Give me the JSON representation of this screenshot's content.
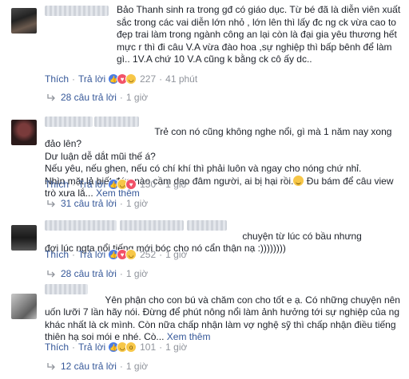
{
  "comments": [
    {
      "text": "Bảo Thanh sinh ra trong gđ có giáo dục. Từ bé đã là diễn viên xuất sắc trong các vai diễn lớn nhỏ , lớn lên thì lấy đc ng ck vừa cao to đẹp trai làm trong ngành công an lại còn là đại gia yêu thương hết mực r thì đi câu V.A vừa đào hoa ,sự nghiệp thì bấp bênh để làm gì.. 1V.A chứ 10 V.A cũng k bằng ck cô ấy dc..",
      "see_more": "",
      "like_label": "Thích",
      "reply_label": "Trả lời",
      "reaction_count": "227",
      "time": "41 phút",
      "replies_label": "28 câu trả lời",
      "replies_time": "1 giờ"
    },
    {
      "text": "Trẻ con nó cũng không nghe nổi, gì mà 1 năm nay xong đảo lên?\nDư luận dễ dắt mũi thế á?\nNếu yêu, nếu ghen, nếu có chí khí thì phải luôn và ngay cho nóng chứ nhỉ.\nNhìn mặt lả biết đứa nào cầm dao đâm người, ai bị hại rồi.",
      "text_tail": " Đu bám để câu view trò xưa lắ...",
      "see_more": "Xem thêm",
      "like_label": "Thích",
      "reply_label": "Trả lời",
      "reaction_count": "150",
      "time": "1 giờ",
      "replies_label": "31 câu trả lời",
      "replies_time": "1 giờ"
    },
    {
      "text": "chuyện từ lúc có bầu nhưng đợi lúc ngta nổi tiếng mới bóc cho nó cẩn thận nạ :))))))))",
      "see_more": "",
      "like_label": "Thích",
      "reply_label": "Trả lời",
      "reaction_count": "252",
      "time": "1 giờ",
      "replies_label": "28 câu trả lời",
      "replies_time": "1 giờ"
    },
    {
      "text": "Yên phận cho con bú và chăm con cho tốt e ạ. Có những chuyện nên uốn lưỡi 7 lần hãy nói. Đừng để phút nông nổi làm ảnh hưởng tới sự nghiệp của ng khác nhất là ck mình. Còn nữa chấp nhận làm vợ nghệ sỹ thì chấp nhận điều tiếng thiên hạ soi mói e nhé. Cò...",
      "see_more": "Xem thêm",
      "like_label": "Thích",
      "reply_label": "Trả lời",
      "reaction_count": "101",
      "time": "1 giờ",
      "replies_label": "12 câu trả lời",
      "replies_time": "1 giờ"
    }
  ],
  "icons": {
    "like": "like-icon",
    "love": "love-icon",
    "haha": "haha-icon",
    "wow": "wow-icon",
    "reply_arrow": "reply-arrow-icon"
  },
  "colors": {
    "link": "#365899",
    "meta": "#90949c",
    "text": "#1d2129",
    "like": "#4c7de4",
    "love": "#f25268",
    "haha": "#f7c748"
  }
}
